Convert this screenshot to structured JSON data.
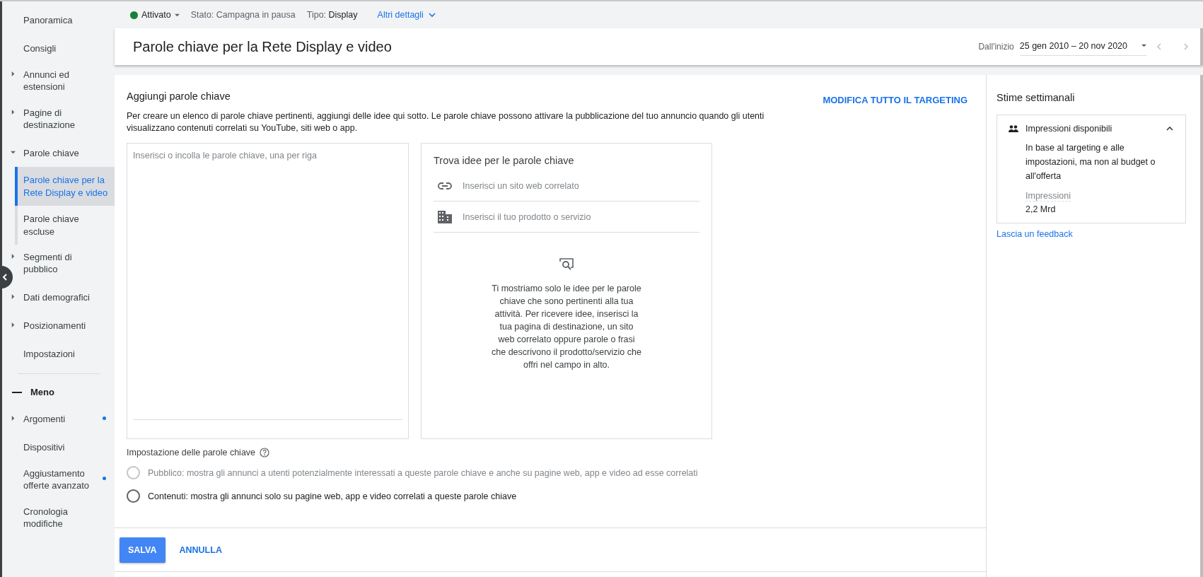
{
  "sidebar": {
    "items": [
      {
        "kind": "link",
        "label": "Panoramica",
        "selected": false,
        "dot": false
      },
      {
        "kind": "link",
        "label": "Consigli",
        "selected": false,
        "dot": false
      },
      {
        "kind": "group",
        "label": "Annunci ed estensioni",
        "expanded": false,
        "selected": false,
        "dot": false
      },
      {
        "kind": "group",
        "label": "Pagine di destinazione",
        "expanded": false,
        "selected": false,
        "dot": false
      },
      {
        "kind": "group",
        "label": "Parole chiave",
        "expanded": true,
        "selected": false,
        "dot": false,
        "children": [
          {
            "label": "Parole chiave per la Rete Display e video",
            "selected": true
          },
          {
            "label": "Parole chiave escluse",
            "selected": false
          }
        ]
      },
      {
        "kind": "group",
        "label": "Segmenti di pubblico",
        "expanded": false,
        "selected": false,
        "dot": false
      },
      {
        "kind": "group",
        "label": "Dati demografici",
        "expanded": false,
        "selected": false,
        "dot": false
      },
      {
        "kind": "group",
        "label": "Posizionamenti",
        "expanded": false,
        "selected": false,
        "dot": false
      },
      {
        "kind": "link",
        "label": "Impostazioni",
        "selected": false,
        "dot": false
      }
    ],
    "toggle": "Meno",
    "more_items": [
      {
        "kind": "group",
        "label": "Argomenti",
        "expanded": false,
        "selected": false,
        "dot": true
      },
      {
        "kind": "link",
        "label": "Dispositivi",
        "selected": false,
        "dot": false
      },
      {
        "kind": "link",
        "label": "Aggiustamento offerte avanzato",
        "selected": false,
        "dot": true
      },
      {
        "kind": "link",
        "label": "Cronologia modifiche",
        "selected": false,
        "dot": false
      }
    ]
  },
  "status_bar": {
    "status": "Attivato",
    "active": true,
    "state_label": "Stato:",
    "state_value": "Campagna in pausa",
    "type_label": "Tipo:",
    "type_value": "Display",
    "details_link": "Altri dettagli"
  },
  "header": {
    "title": "Parole chiave per la Rete Display e video",
    "range_label": "Dall'inizio",
    "range_value": "25 gen 2010 – 20 nov 2020"
  },
  "add_keywords": {
    "title": "Aggiungi parole chiave",
    "edit_link": "MODIFICA TUTTO IL TARGETING",
    "description": "Per creare un elenco di parole chiave pertinenti, aggiungi delle idee qui sotto. Le parole chiave possono attivare la pubblicazione del tuo annuncio quando gli utenti visualizzano contenuti correlati su YouTube, siti web o app.",
    "keywords_placeholder": "Inserisci o incolla le parole chiave, una per riga"
  },
  "ideas": {
    "title": "Trova idee per le parole chiave",
    "fields": [
      {
        "kind": "website",
        "placeholder": "Inserisci un sito web correlato"
      },
      {
        "kind": "product",
        "placeholder": "Inserisci il tuo prodotto o servizio"
      }
    ],
    "hint": "Ti mostriamo solo le idee per le parole chiave che sono pertinenti alla tua attività. Per ricevere idee, inserisci la tua pagina di destinazione, un sito web correlato oppure parole o frasi che descrivono il prodotto/servizio che offri nel campo in alto."
  },
  "keyword_setting": {
    "label": "Impostazione delle parole chiave",
    "options": [
      {
        "label": "Pubblico: mostra gli annunci a utenti potenzialmente interessati a queste parole chiave e anche su pagine web, app e video ad esse correlati",
        "selected": false,
        "disabled": true
      },
      {
        "label": "Contenuti: mostra gli annunci solo su pagine web, app e video correlati a queste parole chiave",
        "selected": false,
        "disabled": false
      }
    ]
  },
  "actions": {
    "save": "SALVA",
    "cancel": "ANNULLA"
  },
  "estimates": {
    "title": "Stime settimanali",
    "card_title": "Impressioni disponibili",
    "expanded": true,
    "description": "In base al targeting e alle impostazioni, ma non al budget o all'offerta",
    "metric_label": "Impressioni",
    "metric_value": "2,2 Mrd",
    "feedback_link": "Lascia un feedback"
  }
}
